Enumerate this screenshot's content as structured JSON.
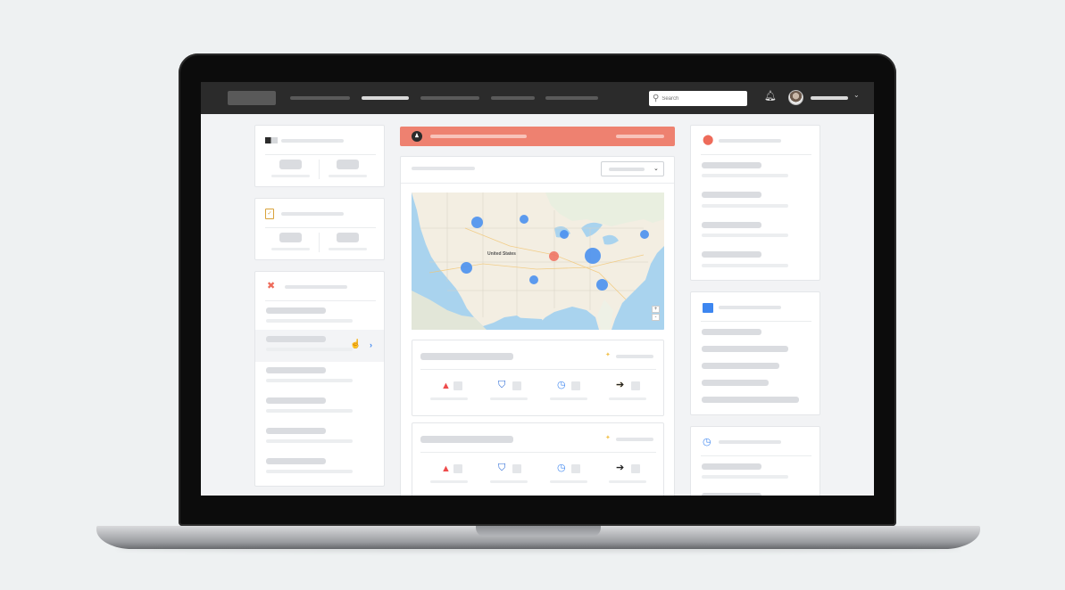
{
  "topbar": {
    "search_placeholder": "Search",
    "bell_icon": "bell-icon",
    "caret": "⌄"
  },
  "left_panel": {
    "card1_icon": "id-card-icon",
    "card2_icon": "clipboard-icon",
    "card3_icon": "tools-icon",
    "chevron": "›"
  },
  "alert": {
    "icon": "person-alert-icon",
    "glyph": "♟"
  },
  "map_card": {
    "dropdown_caret": "⌄",
    "country_label": "United States",
    "zoom_in": "+",
    "zoom_out": "-",
    "markers": [
      {
        "name": "west-north",
        "color": "#4a90f0"
      },
      {
        "name": "north-central",
        "color": "#4a90f0"
      },
      {
        "name": "great-lakes",
        "color": "#4a90f0"
      },
      {
        "name": "northeast",
        "color": "#4a90f0"
      },
      {
        "name": "midwest-large",
        "color": "#4a90f0"
      },
      {
        "name": "central-alert",
        "color": "#ef6f5e"
      },
      {
        "name": "west",
        "color": "#4a90f0"
      },
      {
        "name": "southwest",
        "color": "#4a90f0"
      },
      {
        "name": "southeast",
        "color": "#4a90f0"
      }
    ]
  },
  "stat_cards": [
    {
      "icons": [
        "alarm-icon",
        "shield-icon",
        "clock-icon",
        "arrow-right-icon"
      ]
    },
    {
      "icons": [
        "alarm-icon",
        "shield-icon",
        "clock-icon",
        "arrow-right-icon"
      ]
    }
  ],
  "right_panel": {
    "card1_icon": "location-pin-icon",
    "card2_icon": "calendar-icon",
    "card3_icon": "clock-icon"
  },
  "colors": {
    "accent": "#3d86f0",
    "alert": "#ee8170",
    "topbar": "#2b2b2b"
  }
}
